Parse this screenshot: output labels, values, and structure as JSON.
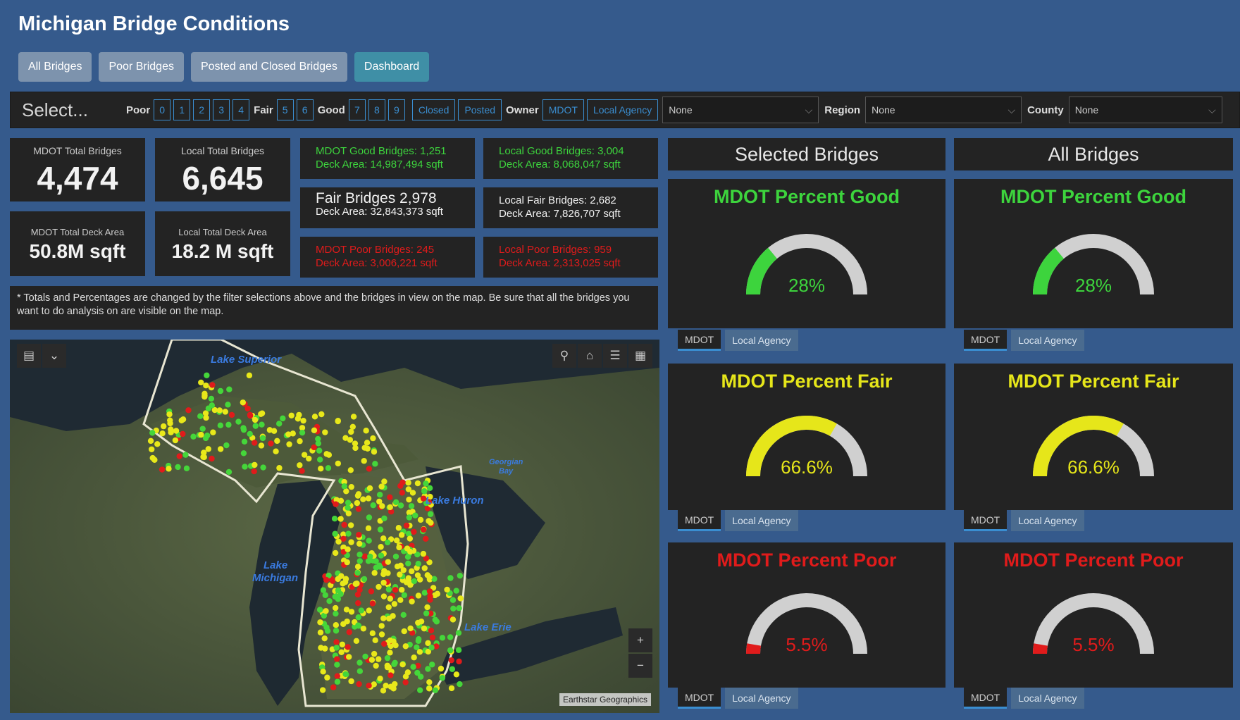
{
  "app": {
    "title": "Michigan Bridge Conditions"
  },
  "tabs": [
    {
      "label": "All Bridges"
    },
    {
      "label": "Poor Bridges"
    },
    {
      "label": "Posted and Closed Bridges"
    },
    {
      "label": "Dashboard"
    }
  ],
  "filters": {
    "select_label": "Select...",
    "poor_label": "Poor",
    "poor_values": [
      "0",
      "1",
      "2",
      "3",
      "4"
    ],
    "fair_label": "Fair",
    "fair_values": [
      "5",
      "6"
    ],
    "good_label": "Good",
    "good_values": [
      "7",
      "8",
      "9"
    ],
    "closed_label": "Closed",
    "posted_label": "Posted",
    "owner_label": "Owner",
    "owner_mdot": "MDOT",
    "owner_local": "Local Agency",
    "owner_dropdown": "None",
    "region_label": "Region",
    "region_dropdown": "None",
    "county_label": "County",
    "county_dropdown": "None"
  },
  "stats": {
    "mdot_total_label": "MDOT Total Bridges",
    "mdot_total": "4,474",
    "local_total_label": "Local Total Bridges",
    "local_total": "6,645",
    "mdot_deck_label": "MDOT Total Deck Area",
    "mdot_deck": "50.8M sqft",
    "local_deck_label": "Local Total Deck Area",
    "local_deck": "18.2 M sqft"
  },
  "conditions": {
    "mdot_good_l1": "MDOT Good Bridges: 1,251",
    "mdot_good_l2": "Deck Area: 14,987,494 sqft",
    "local_good_l1": "Local Good Bridges: 3,004",
    "local_good_l2": "Deck Area: 8,068,047 sqft",
    "mdot_fair_l1": "Fair Bridges 2,978",
    "mdot_fair_l2": "Deck Area: 32,843,373 sqft",
    "local_fair_l1": "Local Fair Bridges: 2,682",
    "local_fair_l2": "Deck Area: 7,826,707 sqft",
    "mdot_poor_l1": "MDOT Poor Bridges: 245",
    "mdot_poor_l2": "Deck Area: 3,006,221 sqft",
    "local_poor_l1": "Local Poor Bridges: 959",
    "local_poor_l2": "Deck Area: 2,313,025 sqft"
  },
  "note": "* Totals and Percentages are changed by the filter selections above and the bridges in view on the map. Be sure that all the bridges you want to do analysis on are visible on the map.",
  "gauge_columns": {
    "selected": "Selected Bridges",
    "all": "All Bridges"
  },
  "gauges": {
    "good_title": "MDOT Percent Good",
    "good_value": "28%",
    "good_fraction": 0.28,
    "fair_title": "MDOT Percent Fair",
    "fair_value": "66.6%",
    "fair_fraction": 0.666,
    "poor_title": "MDOT Percent Poor",
    "poor_value": "5.5%",
    "poor_fraction": 0.055,
    "tab_mdot": "MDOT",
    "tab_local": "Local Agency"
  },
  "colors": {
    "good": "#3dd43d",
    "fair": "#e6e61a",
    "poor": "#e01b1b",
    "track": "#d0d0d0"
  },
  "map": {
    "lake_superior": "Lake Superior",
    "lake_michigan_1": "Lake",
    "lake_michigan_2": "Michigan",
    "lake_huron": "Lake Huron",
    "lake_erie": "Lake Erie",
    "georgian_bay_1": "Georgian",
    "georgian_bay_2": "Bay",
    "attribution": "Earthstar Geographics",
    "zoom_in": "+",
    "zoom_out": "−",
    "icons": [
      "layers-icon",
      "chevron-down-icon",
      "search-icon",
      "home-icon",
      "list-icon",
      "basemap-icon"
    ]
  }
}
